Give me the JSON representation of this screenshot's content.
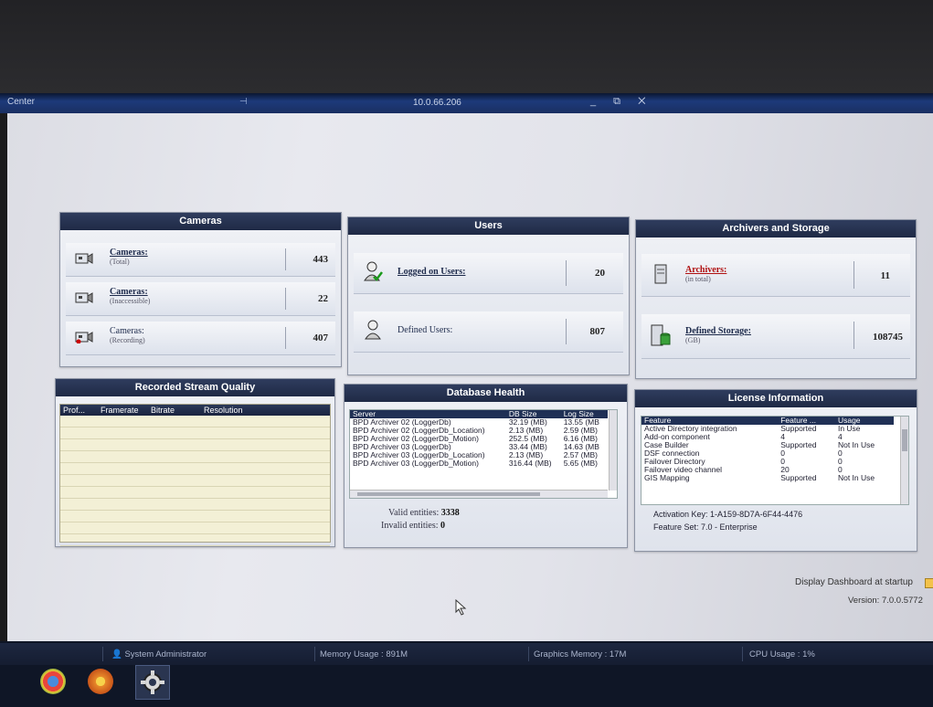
{
  "window": {
    "app_title": "Center",
    "pin_glyph": "⊣",
    "host": "10.0.66.206",
    "controls": "_ ⧉ ✕"
  },
  "cameras": {
    "title": "Cameras",
    "rows": [
      {
        "label": "Cameras:",
        "sub": "(Total)",
        "value": "443"
      },
      {
        "label": "Cameras:",
        "sub": "(Inaccessible)",
        "value": "22"
      },
      {
        "label": "Cameras:",
        "sub": "(Recording)",
        "value": "407"
      }
    ]
  },
  "users": {
    "title": "Users",
    "rows": [
      {
        "label": "Logged on Users:",
        "value": "20"
      },
      {
        "label": "Defined Users:",
        "value": "807"
      }
    ]
  },
  "archivers": {
    "title": "Archivers and Storage",
    "rows": [
      {
        "label": "Archivers:",
        "sub": "(in total)",
        "value": "11"
      },
      {
        "label": "Defined Storage:",
        "sub": "(GB)",
        "value": "108745"
      }
    ]
  },
  "stream_quality": {
    "title": "Recorded Stream Quality",
    "columns": [
      "Prof...",
      "Framerate",
      "Bitrate",
      "Resolution"
    ]
  },
  "db_health": {
    "title": "Database Health",
    "columns": [
      "Server",
      "DB Size",
      "Log Size"
    ],
    "rows": [
      [
        "BPD Archiver 02 (LoggerDb)",
        "32.19 (MB)",
        "13.55 (MB"
      ],
      [
        "BPD Archiver 02 (LoggerDb_Location)",
        "2.13 (MB)",
        "2.59 (MB)"
      ],
      [
        "BPD Archiver 02 (LoggerDb_Motion)",
        "252.5 (MB)",
        "6.16 (MB)"
      ],
      [
        "BPD Archiver 03 (LoggerDb)",
        "33.44 (MB)",
        "14.63 (MB"
      ],
      [
        "BPD Archiver 03 (LoggerDb_Location)",
        "2.13 (MB)",
        "2.57 (MB)"
      ],
      [
        "BPD Archiver 03 (LoggerDb_Motion)",
        "316.44 (MB)",
        "5.65 (MB)"
      ]
    ],
    "valid_label": "Valid entities:",
    "valid_value": "3338",
    "invalid_label": "Invalid entities:",
    "invalid_value": "0"
  },
  "license": {
    "title": "License Information",
    "columns": [
      "Feature",
      "Feature ...",
      "Usage"
    ],
    "rows": [
      [
        "Active Directory integration",
        "Supported",
        "In Use"
      ],
      [
        "Add-on component",
        "4",
        "4"
      ],
      [
        "Case Builder",
        "Supported",
        "Not In Use"
      ],
      [
        "DSF connection",
        "0",
        "0"
      ],
      [
        "Failover Directory",
        "0",
        "0"
      ],
      [
        "Failover video channel",
        "20",
        "0"
      ],
      [
        "GIS Mapping",
        "Supported",
        "Not In Use"
      ]
    ],
    "activation_label": "Activation Key:",
    "activation_value": "1-A159-8D7A-6F44-4476",
    "featureset_label": "Feature Set:",
    "featureset_value": "7.0 - Enterprise"
  },
  "footer": {
    "display_dashboard": "Display Dashboard at startup",
    "version": "Version: 7.0.0.5772"
  },
  "status": {
    "user": "System Administrator",
    "memory": "Memory Usage : 891M",
    "graphics": "Graphics Memory : 17M",
    "cpu": "CPU Usage : 1%"
  }
}
